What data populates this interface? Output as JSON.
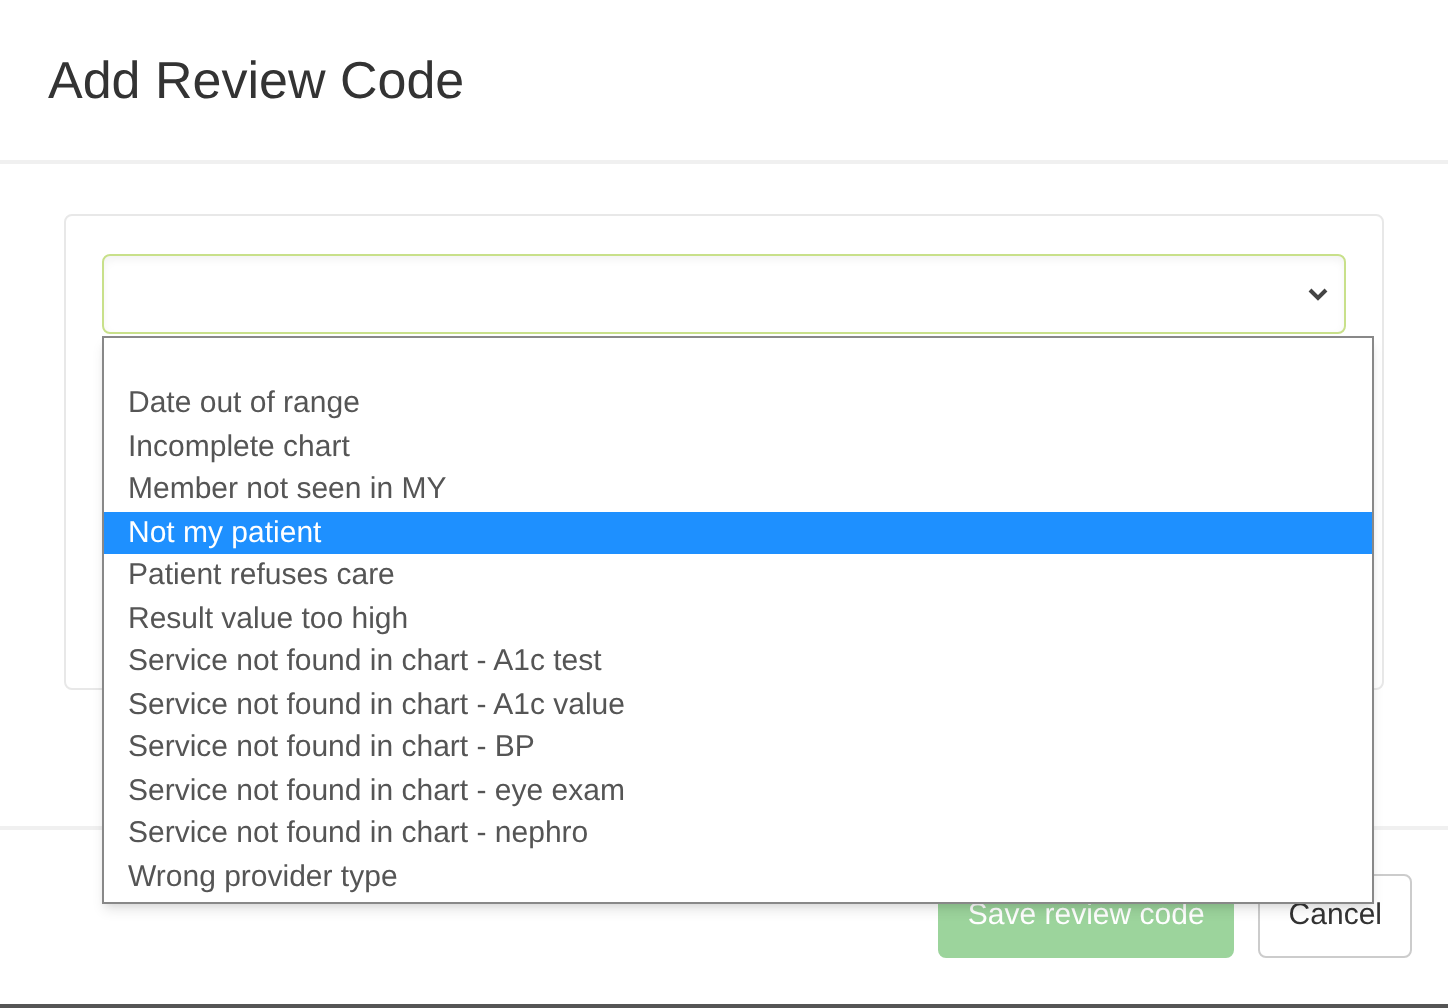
{
  "dialog": {
    "title": "Add Review Code"
  },
  "select": {
    "expanded": true,
    "options": [
      {
        "label": "Date out of range",
        "selected": false
      },
      {
        "label": "Incomplete chart",
        "selected": false
      },
      {
        "label": "Member not seen in MY",
        "selected": false
      },
      {
        "label": "Not my patient",
        "selected": true
      },
      {
        "label": "Patient refuses care",
        "selected": false
      },
      {
        "label": "Result value too high",
        "selected": false
      },
      {
        "label": "Service not found in chart - A1c test",
        "selected": false
      },
      {
        "label": "Service not found in chart - A1c value",
        "selected": false
      },
      {
        "label": "Service not found in chart - BP",
        "selected": false
      },
      {
        "label": "Service not found in chart - eye exam",
        "selected": false
      },
      {
        "label": "Service not found in chart - nephro",
        "selected": false
      },
      {
        "label": "Wrong provider type",
        "selected": false
      }
    ]
  },
  "buttons": [
    {
      "label": "Save review code",
      "kind": "primary",
      "disabled": true
    },
    {
      "label": "Cancel",
      "kind": "secondary",
      "disabled": false
    }
  ]
}
